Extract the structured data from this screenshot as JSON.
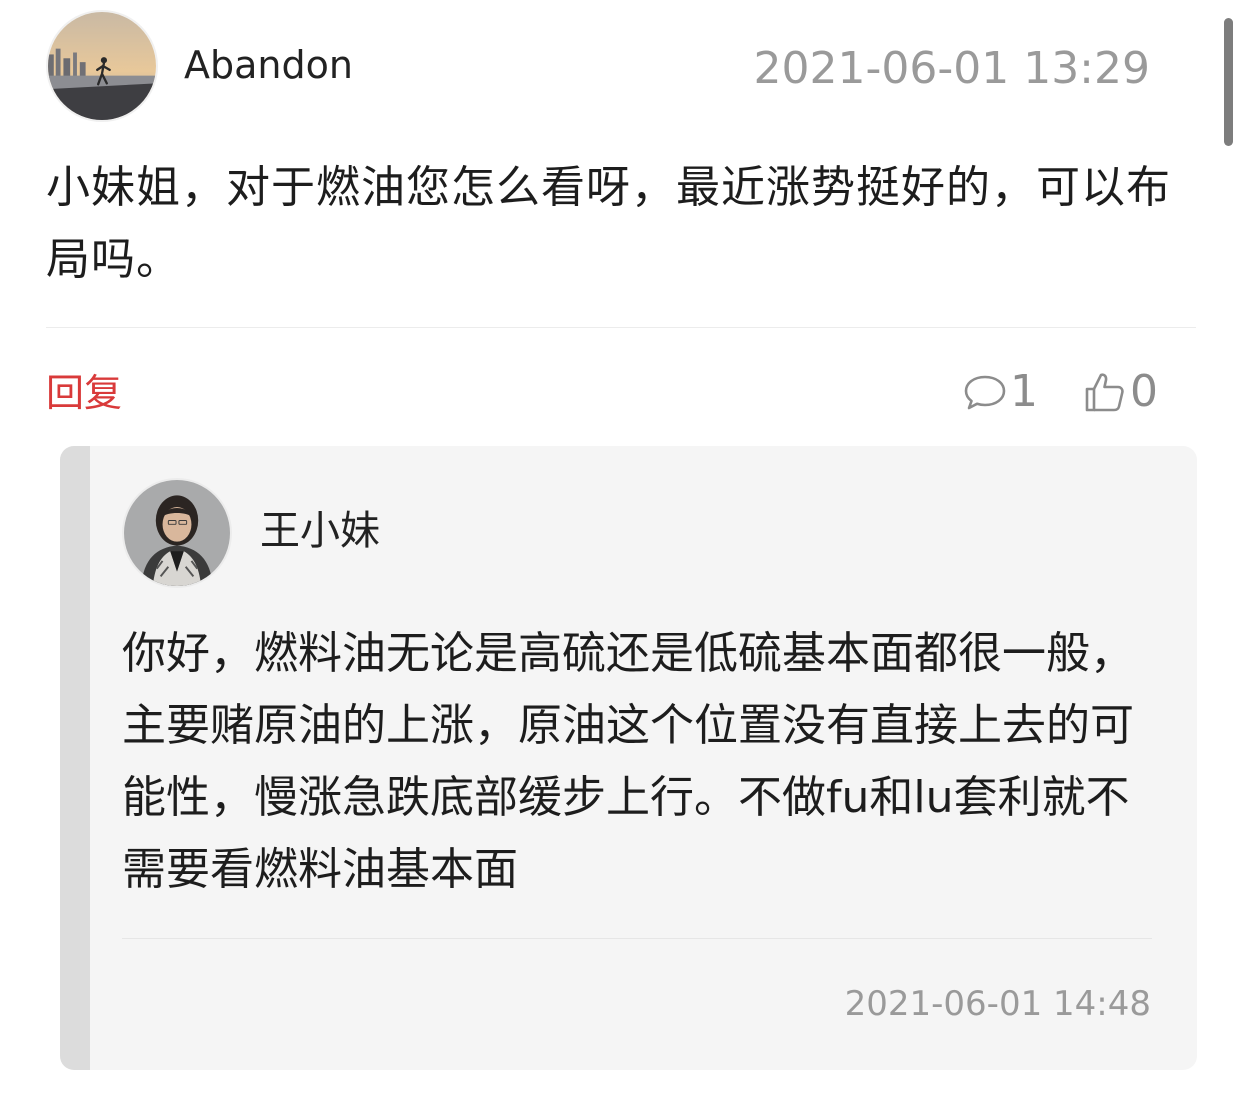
{
  "post": {
    "username": "Abandon",
    "timestamp": "2021-06-01 13:29",
    "content": "小妹姐，对于燃油您怎么看呀，最近涨势挺好的，可以布局吗。"
  },
  "actions": {
    "reply_label": "回复",
    "comment_count": "1",
    "like_count": "0",
    "reply_color": "#d93a3a",
    "icon_color": "#8c8c8c",
    "comment_icon": "speech-bubble-icon",
    "like_icon": "thumbs-up-icon"
  },
  "reply": {
    "username": "王小妹",
    "content": "你好，燃料油无论是高硫还是低硫基本面都很一般，主要赌原油的上涨，原油这个位置没有直接上去的可能性，慢涨急跌底部缓步上行。不做fu和lu套利就不需要看燃料油基本面",
    "timestamp": "2021-06-01 14:48"
  }
}
